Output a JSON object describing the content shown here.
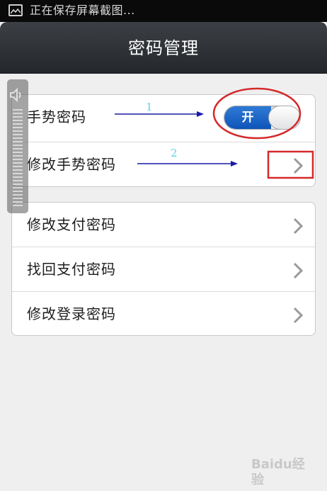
{
  "status_bar": {
    "notification": "正在保存屏幕截图..."
  },
  "header": {
    "title": "密码管理"
  },
  "group1": {
    "gesture_password": {
      "label": "手势密码",
      "toggle_label": "开",
      "enabled": true
    },
    "modify_gesture_password": {
      "label": "修改手势密码"
    }
  },
  "group2": {
    "items": [
      {
        "label": "修改支付密码"
      },
      {
        "label": "找回支付密码"
      },
      {
        "label": "修改登录密码"
      }
    ]
  },
  "annotations": {
    "step1": "1",
    "step2": "2"
  },
  "watermark": {
    "text": "Baidu经验"
  },
  "colors": {
    "toggle_on": "#1565c0",
    "annotation_arrow": "#1a1aa6",
    "annotation_circle": "#d42a2a",
    "annotation_number": "#5fd3e8"
  }
}
